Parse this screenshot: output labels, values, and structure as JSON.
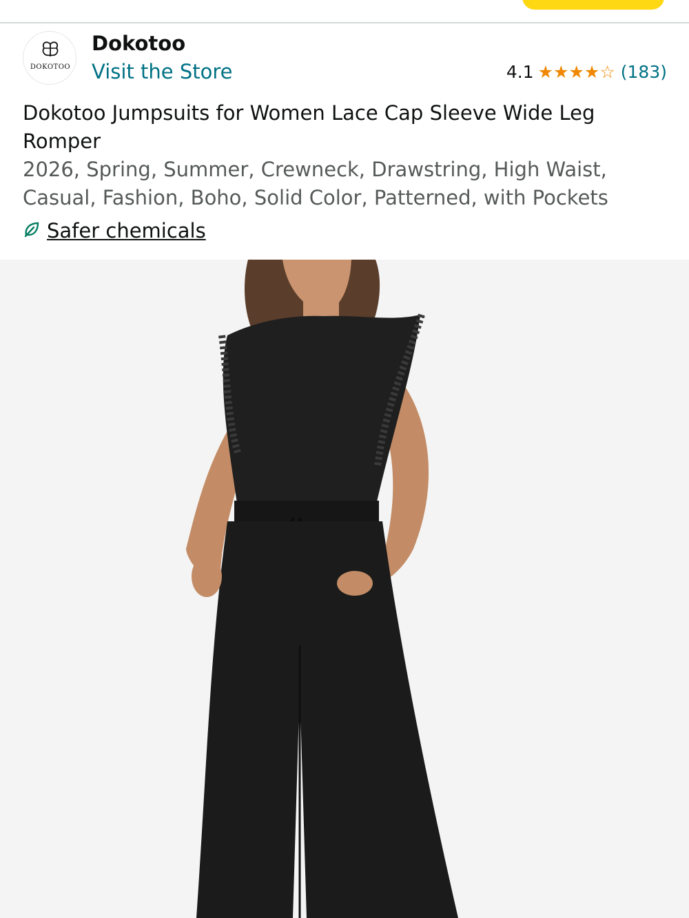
{
  "colors": {
    "accent_button": "#ffd814",
    "link": "#007185",
    "star": "#f08804",
    "text": "#0f1111",
    "muted_text": "#565959",
    "leaf": "#067d62",
    "image_bg": "#f4f4f4",
    "garment": "#1c1c1c"
  },
  "brand": {
    "logo_text": "DOKOTOO",
    "logo_icon": "butterfly-logo",
    "name": "Dokotoo",
    "visit_store": "Visit the Store"
  },
  "rating": {
    "value": "4.1",
    "stars_filled": 4,
    "stars_total": 5,
    "count": "(183)"
  },
  "product": {
    "title": "Dokotoo Jumpsuits for Women Lace Cap Sleeve Wide Leg Romper",
    "subtitle": "2026, Spring, Summer, Crewneck, Drawstring, High Waist, Casual, Fashion, Boho, Solid Color, Patterned, with Pockets"
  },
  "badge": {
    "icon": "leaf-icon",
    "label": "Safer chemicals"
  }
}
